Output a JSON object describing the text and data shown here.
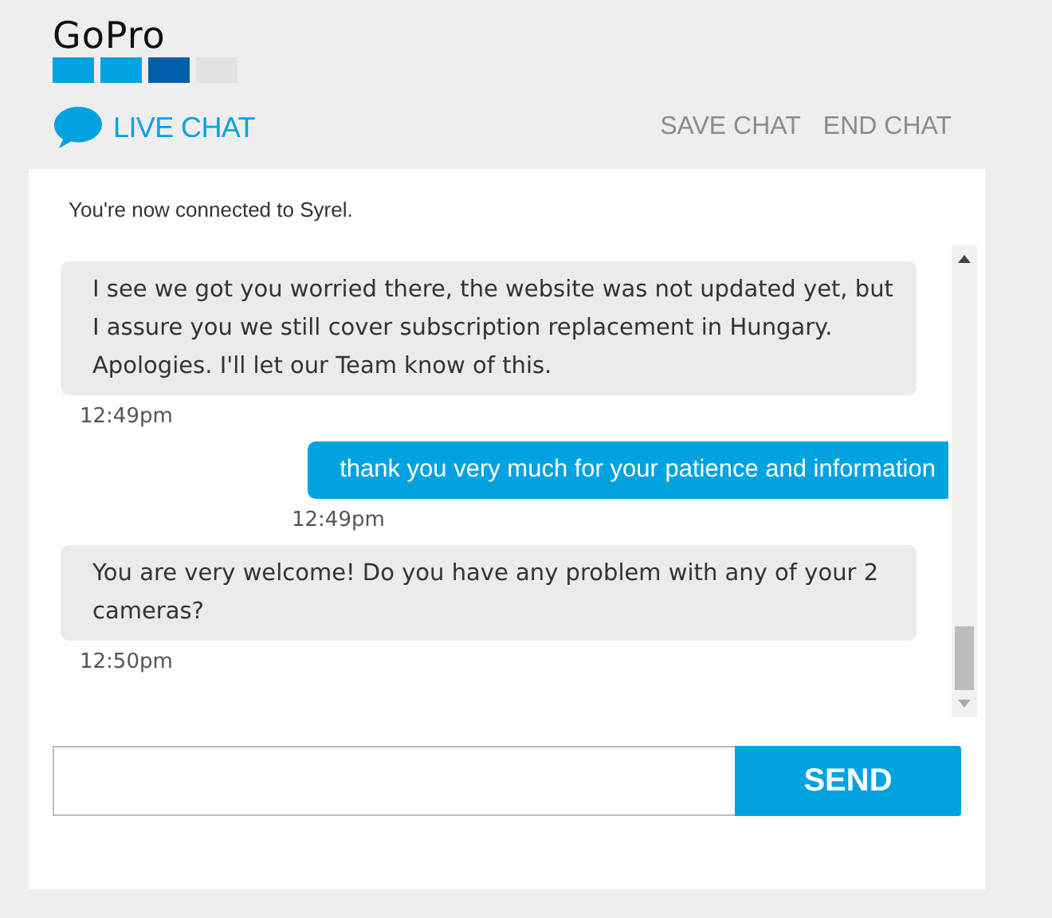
{
  "header": {
    "logo": "GoPro",
    "title": "LIVE CHAT",
    "actions": [
      "SAVE CHAT",
      "END CHAT"
    ]
  },
  "chat": {
    "status": "You're now connected to Syrel.",
    "messages": [
      {
        "kind": "agent",
        "text": "I see we got you worried there, the website was not updated yet, but I assure you we still cover subscription replacement in Hungary. Apologies. I'll let our Team know of this.",
        "time": "12:49pm"
      },
      {
        "kind": "user",
        "text": "thank you very much for your patience and information",
        "time": "12:49pm"
      },
      {
        "kind": "agent",
        "text": "You are very welcome! Do you have any problem with any of your 2 cameras?",
        "time": "12:50pm"
      }
    ]
  },
  "composer": {
    "button": "SEND"
  }
}
